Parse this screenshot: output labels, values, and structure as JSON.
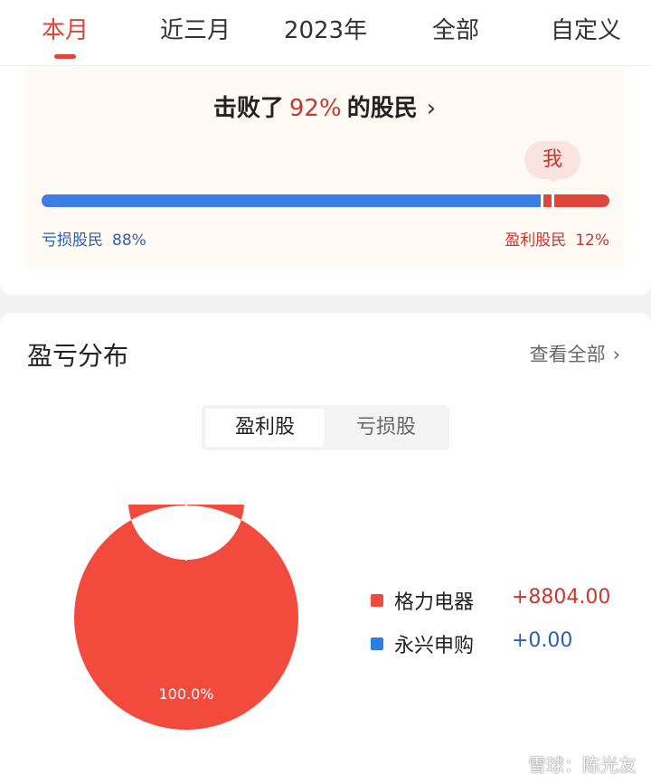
{
  "tabs": [
    "本月",
    "近三月",
    "2023年",
    "全部",
    "自定义"
  ],
  "active_tab": "本月",
  "ranking": {
    "prefix": "击败了",
    "percent": "92%",
    "suffix": "的股民",
    "chevron": "›",
    "me_label": "我",
    "loss_label": "亏损股民",
    "loss_pct": "88%",
    "profit_label": "盈利股民",
    "profit_pct": "12%",
    "loss_fraction": 0.88,
    "me_fraction": 0.9,
    "colors": {
      "loss": "#3d7de6",
      "profit": "#e0463b"
    }
  },
  "distribution": {
    "title": "盈亏分布",
    "view_all": "查看全部",
    "view_all_chevron": "›",
    "segments": [
      "盈利股",
      "亏损股"
    ],
    "active_segment": "盈利股"
  },
  "chart_data": {
    "type": "pie",
    "categories": [
      "格力电器",
      "永兴申购"
    ],
    "values": [
      8804.0,
      0.0
    ],
    "value_labels": [
      "+8804.00",
      "+0.00"
    ],
    "slice_label": "100.0%",
    "colors": [
      "#f24a3d",
      "#2a7de1"
    ],
    "value_colors": [
      "#c9372e",
      "#2d5fb0"
    ],
    "legend": "right"
  },
  "watermark": "雪球：陈光友"
}
